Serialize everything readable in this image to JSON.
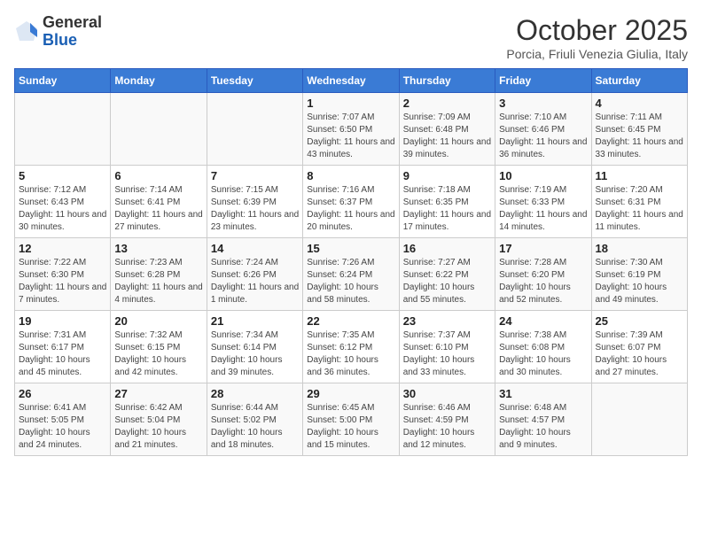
{
  "header": {
    "logo_line1": "General",
    "logo_line2": "Blue",
    "title": "October 2025",
    "subtitle": "Porcia, Friuli Venezia Giulia, Italy"
  },
  "weekdays": [
    "Sunday",
    "Monday",
    "Tuesday",
    "Wednesday",
    "Thursday",
    "Friday",
    "Saturday"
  ],
  "weeks": [
    [
      {
        "day": "",
        "sunrise": "",
        "sunset": "",
        "daylight": ""
      },
      {
        "day": "",
        "sunrise": "",
        "sunset": "",
        "daylight": ""
      },
      {
        "day": "",
        "sunrise": "",
        "sunset": "",
        "daylight": ""
      },
      {
        "day": "1",
        "sunrise": "Sunrise: 7:07 AM",
        "sunset": "Sunset: 6:50 PM",
        "daylight": "Daylight: 11 hours and 43 minutes."
      },
      {
        "day": "2",
        "sunrise": "Sunrise: 7:09 AM",
        "sunset": "Sunset: 6:48 PM",
        "daylight": "Daylight: 11 hours and 39 minutes."
      },
      {
        "day": "3",
        "sunrise": "Sunrise: 7:10 AM",
        "sunset": "Sunset: 6:46 PM",
        "daylight": "Daylight: 11 hours and 36 minutes."
      },
      {
        "day": "4",
        "sunrise": "Sunrise: 7:11 AM",
        "sunset": "Sunset: 6:45 PM",
        "daylight": "Daylight: 11 hours and 33 minutes."
      }
    ],
    [
      {
        "day": "5",
        "sunrise": "Sunrise: 7:12 AM",
        "sunset": "Sunset: 6:43 PM",
        "daylight": "Daylight: 11 hours and 30 minutes."
      },
      {
        "day": "6",
        "sunrise": "Sunrise: 7:14 AM",
        "sunset": "Sunset: 6:41 PM",
        "daylight": "Daylight: 11 hours and 27 minutes."
      },
      {
        "day": "7",
        "sunrise": "Sunrise: 7:15 AM",
        "sunset": "Sunset: 6:39 PM",
        "daylight": "Daylight: 11 hours and 23 minutes."
      },
      {
        "day": "8",
        "sunrise": "Sunrise: 7:16 AM",
        "sunset": "Sunset: 6:37 PM",
        "daylight": "Daylight: 11 hours and 20 minutes."
      },
      {
        "day": "9",
        "sunrise": "Sunrise: 7:18 AM",
        "sunset": "Sunset: 6:35 PM",
        "daylight": "Daylight: 11 hours and 17 minutes."
      },
      {
        "day": "10",
        "sunrise": "Sunrise: 7:19 AM",
        "sunset": "Sunset: 6:33 PM",
        "daylight": "Daylight: 11 hours and 14 minutes."
      },
      {
        "day": "11",
        "sunrise": "Sunrise: 7:20 AM",
        "sunset": "Sunset: 6:31 PM",
        "daylight": "Daylight: 11 hours and 11 minutes."
      }
    ],
    [
      {
        "day": "12",
        "sunrise": "Sunrise: 7:22 AM",
        "sunset": "Sunset: 6:30 PM",
        "daylight": "Daylight: 11 hours and 7 minutes."
      },
      {
        "day": "13",
        "sunrise": "Sunrise: 7:23 AM",
        "sunset": "Sunset: 6:28 PM",
        "daylight": "Daylight: 11 hours and 4 minutes."
      },
      {
        "day": "14",
        "sunrise": "Sunrise: 7:24 AM",
        "sunset": "Sunset: 6:26 PM",
        "daylight": "Daylight: 11 hours and 1 minute."
      },
      {
        "day": "15",
        "sunrise": "Sunrise: 7:26 AM",
        "sunset": "Sunset: 6:24 PM",
        "daylight": "Daylight: 10 hours and 58 minutes."
      },
      {
        "day": "16",
        "sunrise": "Sunrise: 7:27 AM",
        "sunset": "Sunset: 6:22 PM",
        "daylight": "Daylight: 10 hours and 55 minutes."
      },
      {
        "day": "17",
        "sunrise": "Sunrise: 7:28 AM",
        "sunset": "Sunset: 6:20 PM",
        "daylight": "Daylight: 10 hours and 52 minutes."
      },
      {
        "day": "18",
        "sunrise": "Sunrise: 7:30 AM",
        "sunset": "Sunset: 6:19 PM",
        "daylight": "Daylight: 10 hours and 49 minutes."
      }
    ],
    [
      {
        "day": "19",
        "sunrise": "Sunrise: 7:31 AM",
        "sunset": "Sunset: 6:17 PM",
        "daylight": "Daylight: 10 hours and 45 minutes."
      },
      {
        "day": "20",
        "sunrise": "Sunrise: 7:32 AM",
        "sunset": "Sunset: 6:15 PM",
        "daylight": "Daylight: 10 hours and 42 minutes."
      },
      {
        "day": "21",
        "sunrise": "Sunrise: 7:34 AM",
        "sunset": "Sunset: 6:14 PM",
        "daylight": "Daylight: 10 hours and 39 minutes."
      },
      {
        "day": "22",
        "sunrise": "Sunrise: 7:35 AM",
        "sunset": "Sunset: 6:12 PM",
        "daylight": "Daylight: 10 hours and 36 minutes."
      },
      {
        "day": "23",
        "sunrise": "Sunrise: 7:37 AM",
        "sunset": "Sunset: 6:10 PM",
        "daylight": "Daylight: 10 hours and 33 minutes."
      },
      {
        "day": "24",
        "sunrise": "Sunrise: 7:38 AM",
        "sunset": "Sunset: 6:08 PM",
        "daylight": "Daylight: 10 hours and 30 minutes."
      },
      {
        "day": "25",
        "sunrise": "Sunrise: 7:39 AM",
        "sunset": "Sunset: 6:07 PM",
        "daylight": "Daylight: 10 hours and 27 minutes."
      }
    ],
    [
      {
        "day": "26",
        "sunrise": "Sunrise: 6:41 AM",
        "sunset": "Sunset: 5:05 PM",
        "daylight": "Daylight: 10 hours and 24 minutes."
      },
      {
        "day": "27",
        "sunrise": "Sunrise: 6:42 AM",
        "sunset": "Sunset: 5:04 PM",
        "daylight": "Daylight: 10 hours and 21 minutes."
      },
      {
        "day": "28",
        "sunrise": "Sunrise: 6:44 AM",
        "sunset": "Sunset: 5:02 PM",
        "daylight": "Daylight: 10 hours and 18 minutes."
      },
      {
        "day": "29",
        "sunrise": "Sunrise: 6:45 AM",
        "sunset": "Sunset: 5:00 PM",
        "daylight": "Daylight: 10 hours and 15 minutes."
      },
      {
        "day": "30",
        "sunrise": "Sunrise: 6:46 AM",
        "sunset": "Sunset: 4:59 PM",
        "daylight": "Daylight: 10 hours and 12 minutes."
      },
      {
        "day": "31",
        "sunrise": "Sunrise: 6:48 AM",
        "sunset": "Sunset: 4:57 PM",
        "daylight": "Daylight: 10 hours and 9 minutes."
      },
      {
        "day": "",
        "sunrise": "",
        "sunset": "",
        "daylight": ""
      }
    ]
  ]
}
